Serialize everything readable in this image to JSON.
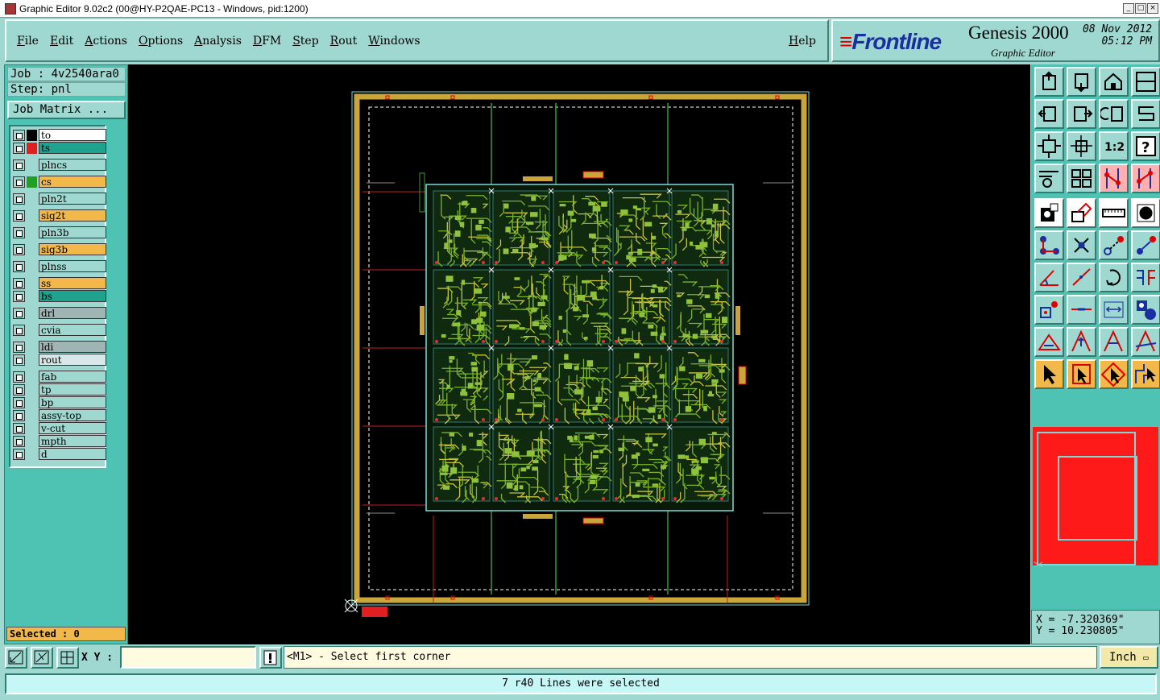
{
  "window": {
    "title": "Graphic Editor 9.02c2 (00@HY-P2QAE-PC13 - Windows, pid:1200)"
  },
  "menu": {
    "items": [
      "File",
      "Edit",
      "Actions",
      "Options",
      "Analysis",
      "DFM",
      "Step",
      "Rout",
      "Windows"
    ],
    "help": "Help"
  },
  "brand": {
    "logo": "Frontline",
    "product": "Genesis 2000",
    "subtitle": "Graphic Editor",
    "date": "08 Nov 2012",
    "time": "05:12 PM"
  },
  "job": {
    "job_label": "Job : 4v2540ara0",
    "step_label": "Step: pnl",
    "matrix_button": "Job Matrix ..."
  },
  "layers": [
    {
      "name": "to",
      "color": "#ffffff",
      "swatch": "#000000"
    },
    {
      "name": "ts",
      "color": "#1fa38f",
      "swatch": "#e02020",
      "active": true
    },
    {
      "name": "plncs",
      "color": "#9fd8d0",
      "swatch": "#9fd8d0"
    },
    {
      "name": "cs",
      "color": "#f2b84a",
      "swatch": "#20a020"
    },
    {
      "name": "pln2t",
      "color": "#9fd8d0",
      "swatch": "#9fd8d0"
    },
    {
      "name": "sig2t",
      "color": "#f2b84a",
      "swatch": "#9fd8d0"
    },
    {
      "name": "pln3b",
      "color": "#9fd8d0",
      "swatch": "#9fd8d0"
    },
    {
      "name": "sig3b",
      "color": "#f2b84a",
      "swatch": "#9fd8d0"
    },
    {
      "name": "plnss",
      "color": "#9fd8d0",
      "swatch": "#9fd8d0"
    },
    {
      "name": "ss",
      "color": "#f2b84a",
      "swatch": "#9fd8d0"
    },
    {
      "name": "bs",
      "color": "#1fa38f",
      "swatch": "#9fd8d0"
    },
    {
      "name": "drl",
      "color": "#a0b4b4",
      "swatch": "#9fd8d0"
    },
    {
      "name": "cvia",
      "color": "#9fd8d0",
      "swatch": "#9fd8d0"
    },
    {
      "name": "ldi",
      "color": "#a0b4b4",
      "swatch": "#9fd8d0"
    },
    {
      "name": "rout",
      "color": "#d8e8e8",
      "swatch": "#9fd8d0"
    },
    {
      "name": "fab",
      "color": "#9fd8d0",
      "swatch": "#9fd8d0"
    },
    {
      "name": "tp",
      "color": "#9fd8d0",
      "swatch": "#9fd8d0"
    },
    {
      "name": "bp",
      "color": "#9fd8d0",
      "swatch": "#9fd8d0"
    },
    {
      "name": "assy-top",
      "color": "#9fd8d0",
      "swatch": "#9fd8d0"
    },
    {
      "name": "v-cut",
      "color": "#9fd8d0",
      "swatch": "#9fd8d0"
    },
    {
      "name": "mpth",
      "color": "#9fd8d0",
      "swatch": "#9fd8d0"
    },
    {
      "name": "d",
      "color": "#9fd8d0",
      "swatch": "#9fd8d0"
    }
  ],
  "selected": "Selected : 0",
  "coords": {
    "x": "X = -7.320369\"",
    "y": "Y = 10.230805\""
  },
  "bottom": {
    "xy_label": "X Y :",
    "xy_value": "",
    "prompt": "<M1> - Select first corner",
    "unit": "Inch"
  },
  "status": "7 r40 Lines were selected",
  "tools": [
    "top-view-icon",
    "bottom-view-icon",
    "home-icon",
    "split-view-icon",
    "pan-left-icon",
    "pan-right-icon",
    "rotate-view-icon",
    "s-curve-icon",
    "zoom-fit-icon",
    "zoom-center-icon",
    "scale-1-2-icon",
    "help-icon",
    "measure-icon",
    "grid-icon",
    "layer-up-icon",
    "layer-down-icon",
    "pad-icon",
    "polygon-icon",
    "ruler-icon",
    "circle-icon",
    "connect-icon",
    "cross-icon",
    "move-point-icon",
    "add-point-icon",
    "angle-icon",
    "line-icon",
    "rotate-icon",
    "snap-icon",
    "node-icon",
    "dash-icon",
    "dimension-icon",
    "shapes-icon",
    "triangle-icon",
    "triangle-up-icon",
    "triangle-a-icon",
    "triangle-b-icon",
    "pointer-icon",
    "select-icon",
    "select-box-icon",
    "route-icon"
  ]
}
